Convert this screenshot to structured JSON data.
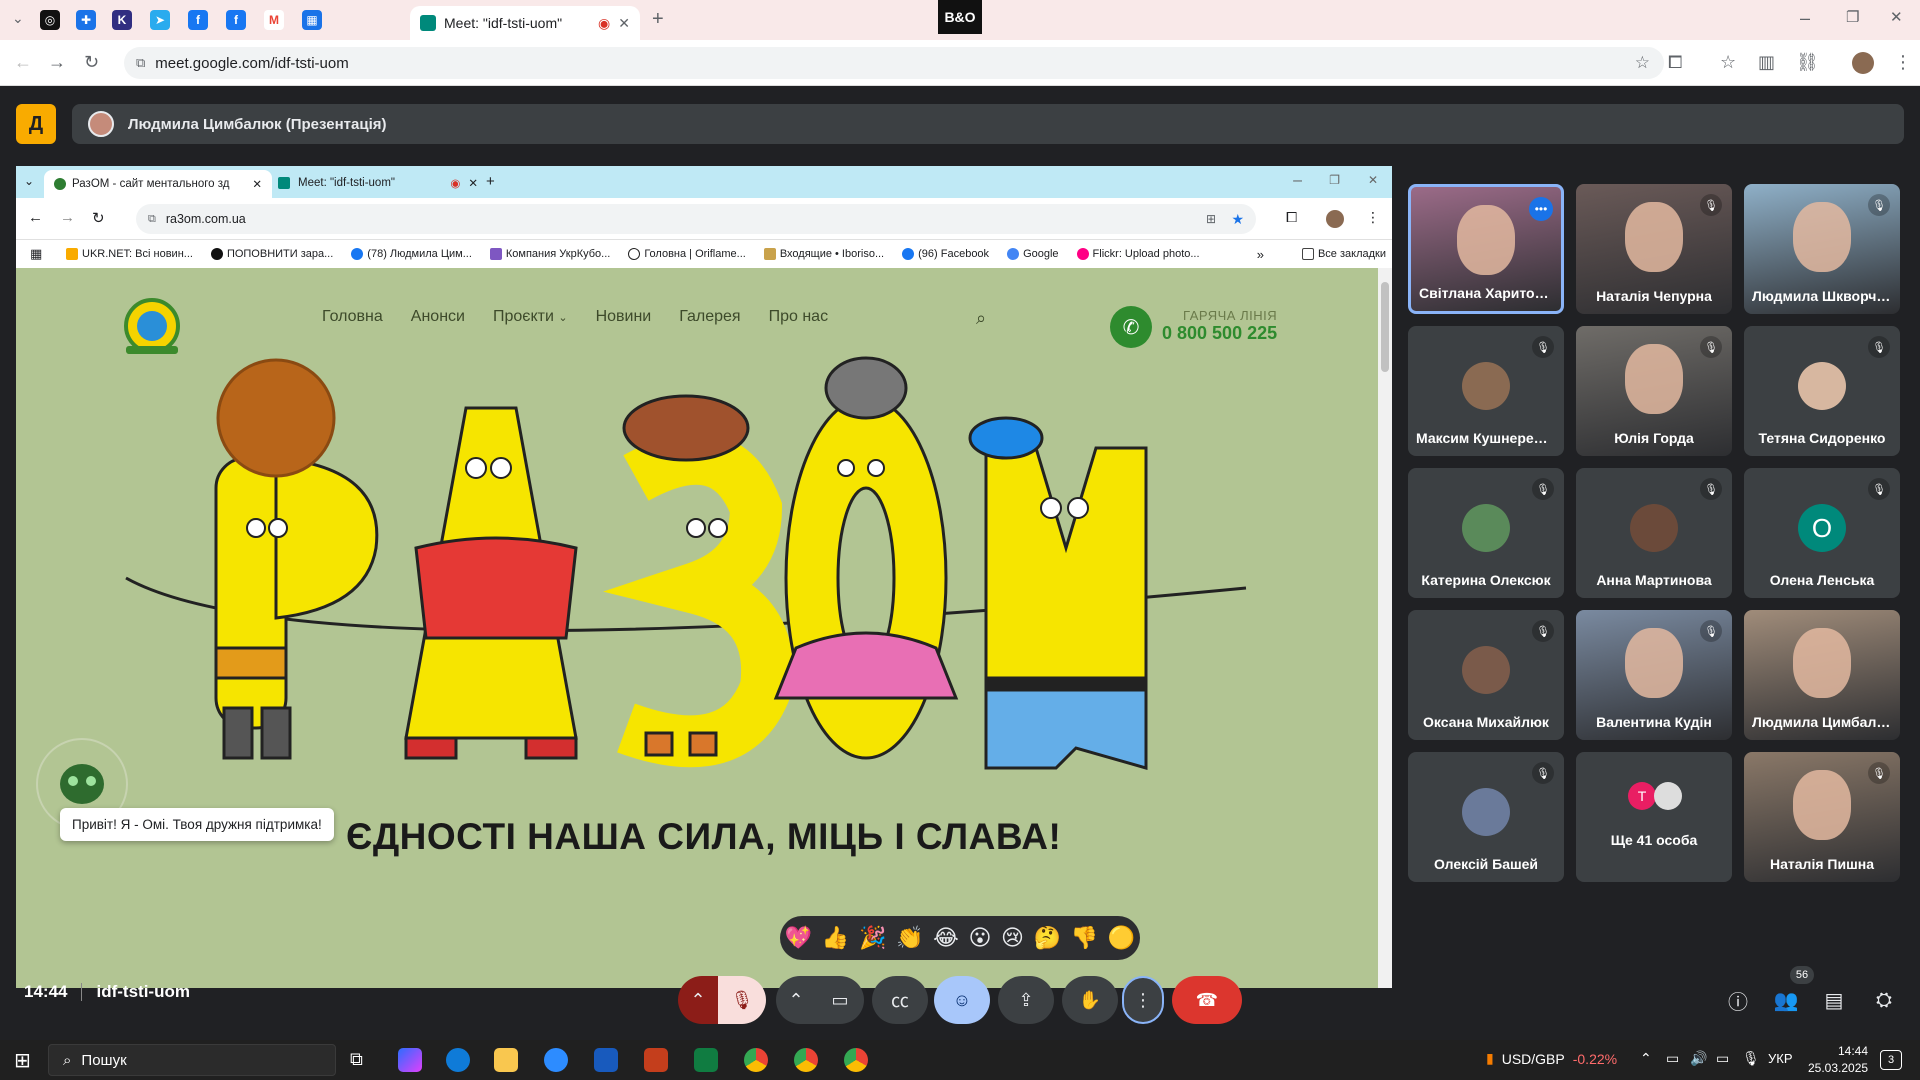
{
  "browser": {
    "active_tab_title": "Meet: \"idf-tsti-uom\"",
    "url": "meet.google.com/idf-tsti-uom",
    "top_logo": "B&O"
  },
  "meet": {
    "presenter": "Людмила Цимбалюк (Презентація)",
    "time": "14:44",
    "code": "idf-tsti-uom",
    "participants_count": "56",
    "tiles": [
      {
        "name": "Світлана Харитонова",
        "kind": "photo",
        "color": "#9b6b88"
      },
      {
        "name": "Наталія Чепурна",
        "kind": "photo",
        "color": "#6a5a58"
      },
      {
        "name": "Людмила Шкворченко",
        "kind": "photo",
        "color": "#8fb0c8"
      },
      {
        "name": "Максим Кушнеренко",
        "kind": "avatar",
        "color": "#8a6a52"
      },
      {
        "name": "Юлія Горда",
        "kind": "photo",
        "color": "#6f6c68"
      },
      {
        "name": "Тетяна Сидоренко",
        "kind": "avatar",
        "color": "#d7b7a0"
      },
      {
        "name": "Катерина Олексюк",
        "kind": "avatar",
        "color": "#5a8a5a"
      },
      {
        "name": "Анна Мартинова",
        "kind": "avatar",
        "color": "#6b4a3a"
      },
      {
        "name": "Олена Ленська",
        "kind": "letter",
        "letter": "О",
        "color": "#00897b"
      },
      {
        "name": "Оксана Михайлюк",
        "kind": "avatar",
        "color": "#7a5a4a"
      },
      {
        "name": "Валентина Кудін",
        "kind": "photo",
        "color": "#7a8aa0"
      },
      {
        "name": "Людмила Цимбалюк",
        "kind": "photo",
        "color": "#a08c7a"
      },
      {
        "name": "Олексій Башей",
        "kind": "avatar",
        "color": "#6a7a9a"
      },
      {
        "name": "Ще 41 особа",
        "kind": "more",
        "color": "#3c4043"
      },
      {
        "name": "Наталія Пишна",
        "kind": "photo",
        "color": "#8a7868"
      }
    ],
    "more_letter": "T",
    "reactions": [
      "💖",
      "👍",
      "🎉",
      "👏",
      "😂",
      "😮",
      "😢",
      "🤔",
      "👎",
      "🟡"
    ]
  },
  "shared": {
    "tab1": "РазОМ - сайт ментального зд",
    "tab2": "Meet: \"idf-tsti-uom\"",
    "url": "ra3om.com.ua",
    "bookmarks": [
      "UKR.NET: Всі новин...",
      "ПОПОВНИТИ зара...",
      "(78) Людмила Цим...",
      "Компания УкрКубо...",
      "Головна | Oriflame...",
      "Входящие • Iboriso...",
      "(96) Facebook",
      "Google",
      "Flickr: Upload photo..."
    ],
    "all_bookmarks": "Все закладки",
    "nav": [
      "Головна",
      "Анонси",
      "Проєкти",
      "Новини",
      "Галерея",
      "Про нас"
    ],
    "hotline_label": "ГАРЯЧА ЛІНІЯ",
    "hotline_number": "0 800 500 225",
    "slogan": "ЄДНОСТІ НАША СИЛА, МІЦЬ І СЛАВА!",
    "chatbot": "Привіт! Я - Омі. Твоя дружня підтримка!"
  },
  "taskbar": {
    "search": "Пошук",
    "ticker_label": "USD/GBP",
    "ticker_value": "-0.22%",
    "lang": "УКР",
    "time": "14:44",
    "date": "25.03.2025",
    "notif": "3"
  }
}
